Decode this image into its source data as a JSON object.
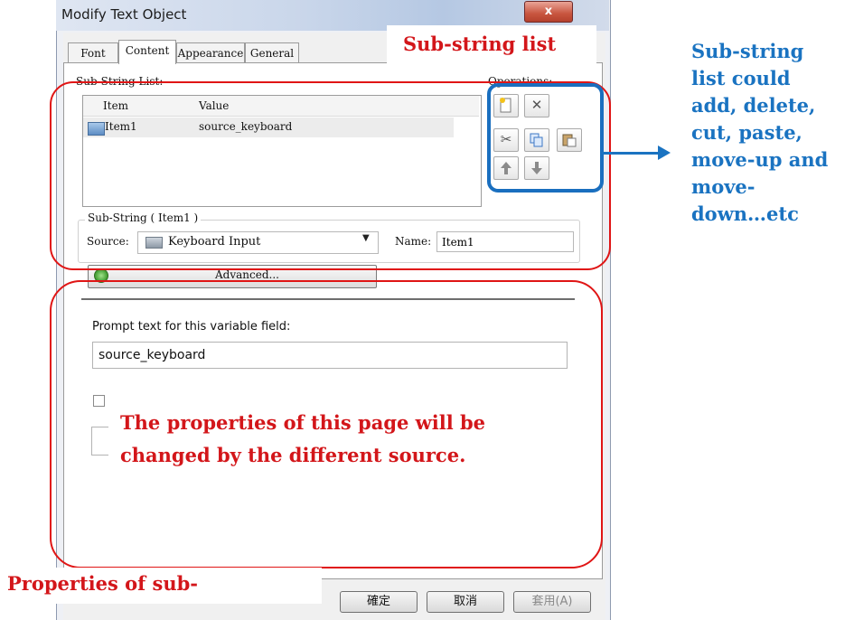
{
  "window": {
    "title": "Modify Text Object",
    "close_glyph": "x"
  },
  "tabs": [
    {
      "label": "Font"
    },
    {
      "label": "Content"
    },
    {
      "label": "Appearance"
    },
    {
      "label": "General"
    }
  ],
  "substring_list": {
    "group_label": "Sub-String List:",
    "columns": [
      "Item",
      "Value"
    ],
    "rows": [
      {
        "item": "Item1",
        "value": "source_keyboard"
      }
    ]
  },
  "operations": {
    "label": "Operations:",
    "icons": [
      "new-icon",
      "delete-icon",
      "cut-icon",
      "copy-icon",
      "paste-icon",
      "move-up-icon",
      "move-down-icon"
    ]
  },
  "substring": {
    "group_label": "Sub-String ( Item1 )",
    "source_label": "Source:",
    "source_value": "Keyboard Input",
    "name_label": "Name:",
    "name_value": "Item1",
    "advanced_label": "Advanced..."
  },
  "properties": {
    "prompt_label": "Prompt text for this variable field:",
    "prompt_value": "source_keyboard"
  },
  "buttons": {
    "ok": "確定",
    "cancel": "取消",
    "apply": "套用(A)"
  },
  "annotations": {
    "substring_list_title": "Sub-string list",
    "side_note_lines": [
      "Sub-string",
      "list could",
      "add, delete,",
      "cut, paste,",
      "move-up and",
      "move-",
      "down…etc"
    ],
    "properties_note_lines": [
      "The properties of this page will be",
      "changed by the different source."
    ],
    "bottom_caption": "Properties of sub-",
    "red_color": "#d3161a",
    "blue_color": "#1a73c1"
  }
}
